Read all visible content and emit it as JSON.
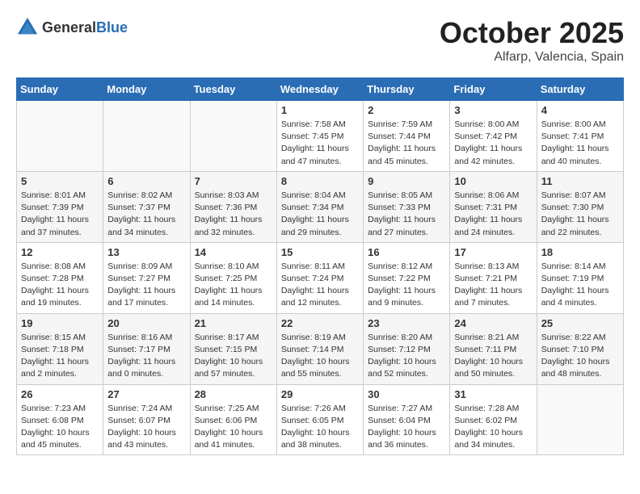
{
  "logo": {
    "general": "General",
    "blue": "Blue"
  },
  "title": {
    "month": "October 2025",
    "location": "Alfarp, Valencia, Spain"
  },
  "weekdays": [
    "Sunday",
    "Monday",
    "Tuesday",
    "Wednesday",
    "Thursday",
    "Friday",
    "Saturday"
  ],
  "weeks": [
    [
      {
        "day": "",
        "info": ""
      },
      {
        "day": "",
        "info": ""
      },
      {
        "day": "",
        "info": ""
      },
      {
        "day": "1",
        "info": "Sunrise: 7:58 AM\nSunset: 7:45 PM\nDaylight: 11 hours and 47 minutes."
      },
      {
        "day": "2",
        "info": "Sunrise: 7:59 AM\nSunset: 7:44 PM\nDaylight: 11 hours and 45 minutes."
      },
      {
        "day": "3",
        "info": "Sunrise: 8:00 AM\nSunset: 7:42 PM\nDaylight: 11 hours and 42 minutes."
      },
      {
        "day": "4",
        "info": "Sunrise: 8:00 AM\nSunset: 7:41 PM\nDaylight: 11 hours and 40 minutes."
      }
    ],
    [
      {
        "day": "5",
        "info": "Sunrise: 8:01 AM\nSunset: 7:39 PM\nDaylight: 11 hours and 37 minutes."
      },
      {
        "day": "6",
        "info": "Sunrise: 8:02 AM\nSunset: 7:37 PM\nDaylight: 11 hours and 34 minutes."
      },
      {
        "day": "7",
        "info": "Sunrise: 8:03 AM\nSunset: 7:36 PM\nDaylight: 11 hours and 32 minutes."
      },
      {
        "day": "8",
        "info": "Sunrise: 8:04 AM\nSunset: 7:34 PM\nDaylight: 11 hours and 29 minutes."
      },
      {
        "day": "9",
        "info": "Sunrise: 8:05 AM\nSunset: 7:33 PM\nDaylight: 11 hours and 27 minutes."
      },
      {
        "day": "10",
        "info": "Sunrise: 8:06 AM\nSunset: 7:31 PM\nDaylight: 11 hours and 24 minutes."
      },
      {
        "day": "11",
        "info": "Sunrise: 8:07 AM\nSunset: 7:30 PM\nDaylight: 11 hours and 22 minutes."
      }
    ],
    [
      {
        "day": "12",
        "info": "Sunrise: 8:08 AM\nSunset: 7:28 PM\nDaylight: 11 hours and 19 minutes."
      },
      {
        "day": "13",
        "info": "Sunrise: 8:09 AM\nSunset: 7:27 PM\nDaylight: 11 hours and 17 minutes."
      },
      {
        "day": "14",
        "info": "Sunrise: 8:10 AM\nSunset: 7:25 PM\nDaylight: 11 hours and 14 minutes."
      },
      {
        "day": "15",
        "info": "Sunrise: 8:11 AM\nSunset: 7:24 PM\nDaylight: 11 hours and 12 minutes."
      },
      {
        "day": "16",
        "info": "Sunrise: 8:12 AM\nSunset: 7:22 PM\nDaylight: 11 hours and 9 minutes."
      },
      {
        "day": "17",
        "info": "Sunrise: 8:13 AM\nSunset: 7:21 PM\nDaylight: 11 hours and 7 minutes."
      },
      {
        "day": "18",
        "info": "Sunrise: 8:14 AM\nSunset: 7:19 PM\nDaylight: 11 hours and 4 minutes."
      }
    ],
    [
      {
        "day": "19",
        "info": "Sunrise: 8:15 AM\nSunset: 7:18 PM\nDaylight: 11 hours and 2 minutes."
      },
      {
        "day": "20",
        "info": "Sunrise: 8:16 AM\nSunset: 7:17 PM\nDaylight: 11 hours and 0 minutes."
      },
      {
        "day": "21",
        "info": "Sunrise: 8:17 AM\nSunset: 7:15 PM\nDaylight: 10 hours and 57 minutes."
      },
      {
        "day": "22",
        "info": "Sunrise: 8:19 AM\nSunset: 7:14 PM\nDaylight: 10 hours and 55 minutes."
      },
      {
        "day": "23",
        "info": "Sunrise: 8:20 AM\nSunset: 7:12 PM\nDaylight: 10 hours and 52 minutes."
      },
      {
        "day": "24",
        "info": "Sunrise: 8:21 AM\nSunset: 7:11 PM\nDaylight: 10 hours and 50 minutes."
      },
      {
        "day": "25",
        "info": "Sunrise: 8:22 AM\nSunset: 7:10 PM\nDaylight: 10 hours and 48 minutes."
      }
    ],
    [
      {
        "day": "26",
        "info": "Sunrise: 7:23 AM\nSunset: 6:08 PM\nDaylight: 10 hours and 45 minutes."
      },
      {
        "day": "27",
        "info": "Sunrise: 7:24 AM\nSunset: 6:07 PM\nDaylight: 10 hours and 43 minutes."
      },
      {
        "day": "28",
        "info": "Sunrise: 7:25 AM\nSunset: 6:06 PM\nDaylight: 10 hours and 41 minutes."
      },
      {
        "day": "29",
        "info": "Sunrise: 7:26 AM\nSunset: 6:05 PM\nDaylight: 10 hours and 38 minutes."
      },
      {
        "day": "30",
        "info": "Sunrise: 7:27 AM\nSunset: 6:04 PM\nDaylight: 10 hours and 36 minutes."
      },
      {
        "day": "31",
        "info": "Sunrise: 7:28 AM\nSunset: 6:02 PM\nDaylight: 10 hours and 34 minutes."
      },
      {
        "day": "",
        "info": ""
      }
    ]
  ]
}
